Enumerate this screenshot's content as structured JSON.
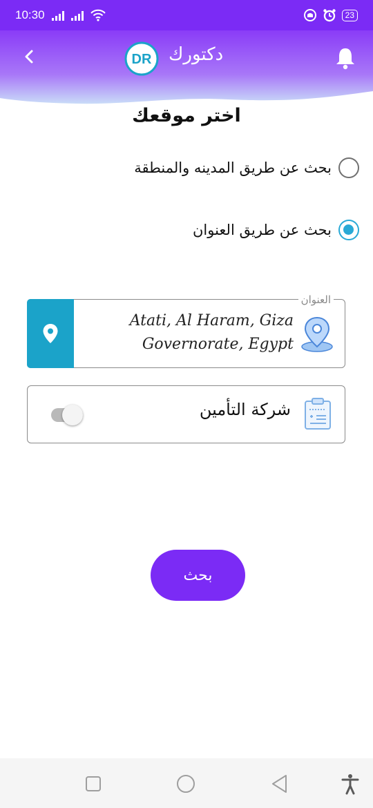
{
  "status_bar": {
    "time": "10:30",
    "battery": "23",
    "icons": [
      "signal-icon",
      "signal-icon",
      "wifi-icon",
      "notification-icon",
      "alarm-icon",
      "battery-icon"
    ]
  },
  "header": {
    "app_title": "دكتورك",
    "logo_text": "DR",
    "icons": [
      "back-arrow-icon",
      "logo-icon",
      "bell-icon"
    ]
  },
  "page": {
    "title": "اختر موقعك"
  },
  "search_modes": [
    {
      "label": "بحث عن طريق المدينه والمنطقة",
      "selected": false
    },
    {
      "label": "بحث عن طريق العنوان",
      "selected": true
    }
  ],
  "address_field": {
    "label": "العنوان",
    "line1": "Atati, Al Haram, Giza",
    "line2": "Governorate, Egypt",
    "icons": [
      "location-pin-icon",
      "map-pin-icon"
    ]
  },
  "insurance": {
    "label": "شركة التأمين",
    "enabled": false,
    "icons": [
      "medical-clipboard-icon"
    ]
  },
  "search_button": {
    "label": "بحث"
  },
  "colors": {
    "primary": "#7b2bf5",
    "accent": "#29a9d6",
    "pin_cell": "#1ba3c9"
  },
  "nav_bar": {
    "icons": [
      "recents-icon",
      "home-icon",
      "back-icon",
      "accessibility-icon"
    ]
  }
}
